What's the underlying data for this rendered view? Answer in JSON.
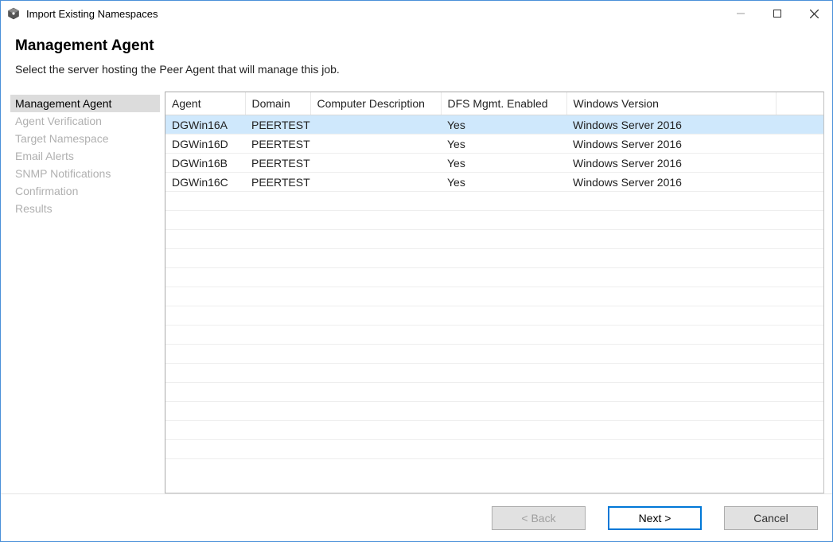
{
  "window": {
    "title": "Import Existing Namespaces"
  },
  "header": {
    "title": "Management Agent",
    "subtitle": "Select the server hosting the Peer Agent that will manage this job."
  },
  "sidebar": {
    "steps": [
      "Management Agent",
      "Agent Verification",
      "Target Namespace",
      "Email Alerts",
      "SNMP Notifications",
      "Confirmation",
      "Results"
    ],
    "active_index": 0
  },
  "table": {
    "columns": {
      "agent": "Agent",
      "domain": "Domain",
      "desc": "Computer Description",
      "dfs": "DFS Mgmt. Enabled",
      "winver": "Windows Version"
    },
    "rows": [
      {
        "agent": "DGWin16A",
        "domain": "PEERTEST",
        "desc": "",
        "dfs": "Yes",
        "winver": "Windows Server 2016",
        "selected": true
      },
      {
        "agent": "DGWin16D",
        "domain": "PEERTEST",
        "desc": "",
        "dfs": "Yes",
        "winver": "Windows Server 2016",
        "selected": false
      },
      {
        "agent": "DGWin16B",
        "domain": "PEERTEST",
        "desc": "",
        "dfs": "Yes",
        "winver": "Windows Server 2016",
        "selected": false
      },
      {
        "agent": "DGWin16C",
        "domain": "PEERTEST",
        "desc": "",
        "dfs": "Yes",
        "winver": "Windows Server 2016",
        "selected": false
      }
    ],
    "empty_rows": 14
  },
  "footer": {
    "back": "< Back",
    "next": "Next >",
    "cancel": "Cancel"
  }
}
